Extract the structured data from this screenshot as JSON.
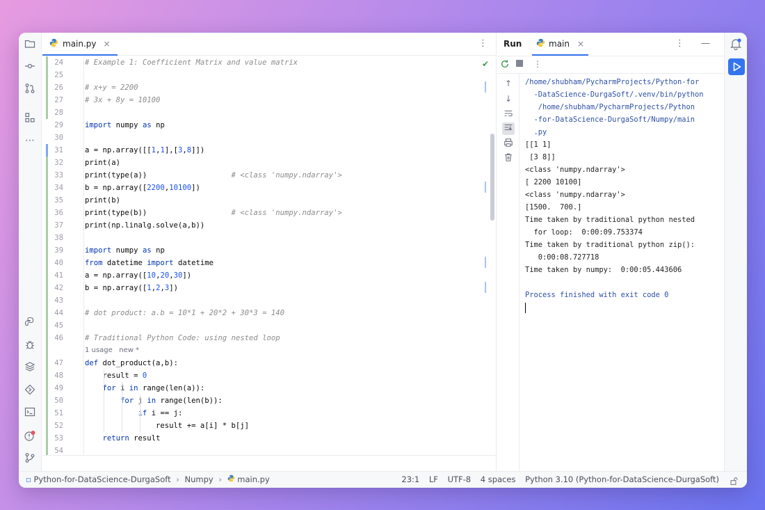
{
  "editor": {
    "tab_label": "main.py",
    "tab_close": "×",
    "menu": "⋮",
    "lines": [
      {
        "n": "24",
        "parts": [
          [
            "c",
            "# Example 1: Coefficient Matrix and value matrix"
          ]
        ]
      },
      {
        "n": "25",
        "parts": []
      },
      {
        "n": "26",
        "parts": [
          [
            "c",
            "# x+y = 2200"
          ]
        ]
      },
      {
        "n": "27",
        "parts": [
          [
            "c",
            "# 3x + 8y = 10100"
          ]
        ]
      },
      {
        "n": "28",
        "parts": []
      },
      {
        "n": "29",
        "parts": [
          [
            "k",
            "import"
          ],
          [
            "t",
            " numpy "
          ],
          [
            "k",
            "as"
          ],
          [
            "t",
            " np"
          ]
        ]
      },
      {
        "n": "30",
        "parts": []
      },
      {
        "n": "31",
        "parts": [
          [
            "t",
            "a = np.array([["
          ],
          [
            "n",
            "1"
          ],
          [
            "t",
            ","
          ],
          [
            "n",
            "1"
          ],
          [
            "t",
            "],["
          ],
          [
            "n",
            "3"
          ],
          [
            "t",
            ","
          ],
          [
            "n",
            "8"
          ],
          [
            "t",
            "]])"
          ]
        ]
      },
      {
        "n": "32",
        "parts": [
          [
            "t",
            "print(a)"
          ]
        ]
      },
      {
        "n": "33",
        "parts": [
          [
            "t",
            "print(type(a))                   "
          ],
          [
            "c",
            "# <class 'numpy.ndarray'>"
          ]
        ]
      },
      {
        "n": "34",
        "parts": [
          [
            "t",
            "b = np.array(["
          ],
          [
            "n",
            "2200"
          ],
          [
            "t",
            ","
          ],
          [
            "n",
            "10100"
          ],
          [
            "t",
            "])"
          ]
        ]
      },
      {
        "n": "35",
        "parts": [
          [
            "t",
            "print(b)"
          ]
        ]
      },
      {
        "n": "36",
        "parts": [
          [
            "t",
            "print(type(b))                   "
          ],
          [
            "c",
            "# <class 'numpy.ndarray'>"
          ]
        ]
      },
      {
        "n": "37",
        "parts": [
          [
            "t",
            "print(np.linalg.solve(a,b))"
          ]
        ]
      },
      {
        "n": "38",
        "parts": []
      },
      {
        "n": "39",
        "parts": [
          [
            "k",
            "import"
          ],
          [
            "t",
            " numpy "
          ],
          [
            "k",
            "as"
          ],
          [
            "t",
            " np"
          ]
        ]
      },
      {
        "n": "40",
        "parts": [
          [
            "k",
            "from"
          ],
          [
            "t",
            " datetime "
          ],
          [
            "k",
            "import"
          ],
          [
            "t",
            " datetime"
          ]
        ]
      },
      {
        "n": "41",
        "parts": [
          [
            "t",
            "a = np.array(["
          ],
          [
            "n",
            "10"
          ],
          [
            "t",
            ","
          ],
          [
            "n",
            "20"
          ],
          [
            "t",
            ","
          ],
          [
            "n",
            "30"
          ],
          [
            "t",
            "])"
          ]
        ]
      },
      {
        "n": "42",
        "parts": [
          [
            "t",
            "b = np.array(["
          ],
          [
            "n",
            "1"
          ],
          [
            "t",
            ","
          ],
          [
            "n",
            "2"
          ],
          [
            "t",
            ","
          ],
          [
            "n",
            "3"
          ],
          [
            "t",
            "])"
          ]
        ]
      },
      {
        "n": "43",
        "parts": []
      },
      {
        "n": "44",
        "parts": [
          [
            "c",
            "# dot product: a.b = 10*1 + 20*2 + 30*3 = 140"
          ]
        ]
      },
      {
        "n": "45",
        "parts": []
      },
      {
        "n": "46",
        "parts": [
          [
            "c",
            "# Traditional Python Code: using nested loop"
          ]
        ]
      },
      {
        "n": "",
        "hint": "1 usage   new *"
      },
      {
        "n": "47",
        "parts": [
          [
            "k",
            "def"
          ],
          [
            "t",
            " dot_product(a,b):"
          ]
        ]
      },
      {
        "n": "48",
        "parts": [
          [
            "t",
            "    result = "
          ],
          [
            "n",
            "0"
          ]
        ]
      },
      {
        "n": "49",
        "parts": [
          [
            "t",
            "    "
          ],
          [
            "k",
            "for"
          ],
          [
            "t",
            " i "
          ],
          [
            "k",
            "in"
          ],
          [
            "t",
            " range(len(a)):"
          ]
        ]
      },
      {
        "n": "50",
        "parts": [
          [
            "t",
            "        "
          ],
          [
            "k",
            "for"
          ],
          [
            "t",
            " j "
          ],
          [
            "k",
            "in"
          ],
          [
            "t",
            " range(len(b)):"
          ]
        ]
      },
      {
        "n": "51",
        "parts": [
          [
            "t",
            "            "
          ],
          [
            "k",
            "if"
          ],
          [
            "t",
            " i == j:"
          ]
        ]
      },
      {
        "n": "52",
        "parts": [
          [
            "t",
            "                result += a[i] * b[j]"
          ]
        ]
      },
      {
        "n": "53",
        "parts": [
          [
            "t",
            "    "
          ],
          [
            "k",
            "return"
          ],
          [
            "t",
            " result"
          ]
        ]
      },
      {
        "n": "54",
        "parts": []
      }
    ]
  },
  "run": {
    "title": "Run",
    "tab_label": "main",
    "tab_close": "×",
    "controls": "⋮ —",
    "console_lines": [
      {
        "cls": "path",
        "text": "/home/shubham/PycharmProjects/Python-for"
      },
      {
        "cls": "path",
        "text": "  -DataScience-DurgaSoft/.venv/bin/python"
      },
      {
        "cls": "path",
        "text": "   /home/shubham/PycharmProjects/Python"
      },
      {
        "cls": "path",
        "text": "  -for-DataScience-DurgaSoft/Numpy/main"
      },
      {
        "cls": "path",
        "text": "  .py"
      },
      {
        "cls": "",
        "text": "[[1 1]"
      },
      {
        "cls": "",
        "text": " [3 8]]"
      },
      {
        "cls": "",
        "text": "<class 'numpy.ndarray'>"
      },
      {
        "cls": "",
        "text": "[ 2200 10100]"
      },
      {
        "cls": "",
        "text": "<class 'numpy.ndarray'>"
      },
      {
        "cls": "",
        "text": "[1500.  700.]"
      },
      {
        "cls": "",
        "text": "Time taken by traditional python nested"
      },
      {
        "cls": "",
        "text": "  for loop:  0:00:09.753374"
      },
      {
        "cls": "",
        "text": "Time taken by traditional python zip():"
      },
      {
        "cls": "",
        "text": "   0:00:08.727718"
      },
      {
        "cls": "",
        "text": "Time taken by numpy:  0:00:05.443606"
      },
      {
        "cls": "",
        "text": ""
      },
      {
        "cls": "path",
        "text": "Process finished with exit code 0"
      }
    ]
  },
  "status": {
    "project": "Python-for-DataScience-DurgaSoft",
    "folder": "Numpy",
    "file": "main.py",
    "position": "23:1",
    "line_sep": "LF",
    "encoding": "UTF-8",
    "indent": "4 spaces",
    "interpreter": "Python 3.10 (Python-for-DataScience-DurgaSoft)"
  },
  "colors": {
    "accent": "#3574f0",
    "keyword": "#0033b3",
    "number": "#1750eb",
    "comment": "#8c8c8c"
  }
}
